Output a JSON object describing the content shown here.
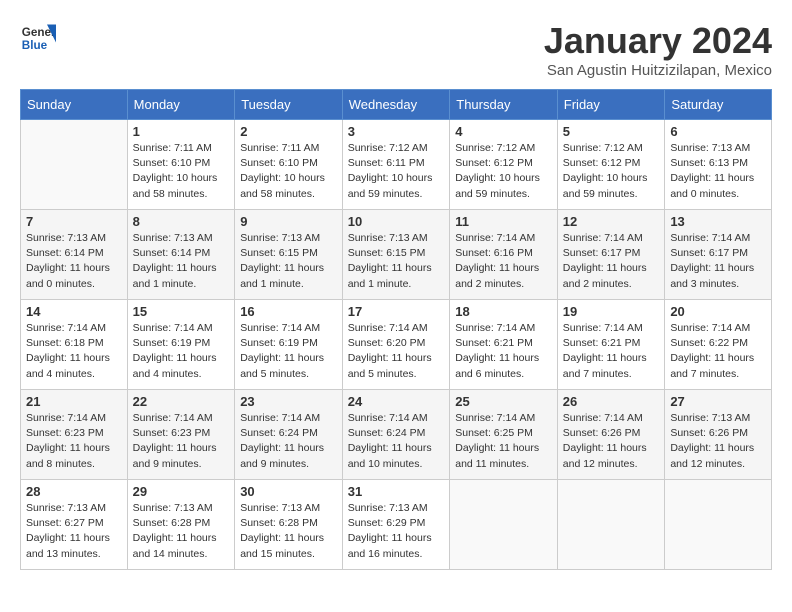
{
  "logo": {
    "line1": "General",
    "line2": "Blue"
  },
  "title": "January 2024",
  "subtitle": "San Agustin Huitzizilapan, Mexico",
  "weekdays": [
    "Sunday",
    "Monday",
    "Tuesday",
    "Wednesday",
    "Thursday",
    "Friday",
    "Saturday"
  ],
  "weeks": [
    [
      {
        "day": "",
        "info": ""
      },
      {
        "day": "1",
        "info": "Sunrise: 7:11 AM\nSunset: 6:10 PM\nDaylight: 10 hours\nand 58 minutes."
      },
      {
        "day": "2",
        "info": "Sunrise: 7:11 AM\nSunset: 6:10 PM\nDaylight: 10 hours\nand 58 minutes."
      },
      {
        "day": "3",
        "info": "Sunrise: 7:12 AM\nSunset: 6:11 PM\nDaylight: 10 hours\nand 59 minutes."
      },
      {
        "day": "4",
        "info": "Sunrise: 7:12 AM\nSunset: 6:12 PM\nDaylight: 10 hours\nand 59 minutes."
      },
      {
        "day": "5",
        "info": "Sunrise: 7:12 AM\nSunset: 6:12 PM\nDaylight: 10 hours\nand 59 minutes."
      },
      {
        "day": "6",
        "info": "Sunrise: 7:13 AM\nSunset: 6:13 PM\nDaylight: 11 hours\nand 0 minutes."
      }
    ],
    [
      {
        "day": "7",
        "info": "Sunrise: 7:13 AM\nSunset: 6:14 PM\nDaylight: 11 hours\nand 0 minutes."
      },
      {
        "day": "8",
        "info": "Sunrise: 7:13 AM\nSunset: 6:14 PM\nDaylight: 11 hours\nand 1 minute."
      },
      {
        "day": "9",
        "info": "Sunrise: 7:13 AM\nSunset: 6:15 PM\nDaylight: 11 hours\nand 1 minute."
      },
      {
        "day": "10",
        "info": "Sunrise: 7:13 AM\nSunset: 6:15 PM\nDaylight: 11 hours\nand 1 minute."
      },
      {
        "day": "11",
        "info": "Sunrise: 7:14 AM\nSunset: 6:16 PM\nDaylight: 11 hours\nand 2 minutes."
      },
      {
        "day": "12",
        "info": "Sunrise: 7:14 AM\nSunset: 6:17 PM\nDaylight: 11 hours\nand 2 minutes."
      },
      {
        "day": "13",
        "info": "Sunrise: 7:14 AM\nSunset: 6:17 PM\nDaylight: 11 hours\nand 3 minutes."
      }
    ],
    [
      {
        "day": "14",
        "info": "Sunrise: 7:14 AM\nSunset: 6:18 PM\nDaylight: 11 hours\nand 4 minutes."
      },
      {
        "day": "15",
        "info": "Sunrise: 7:14 AM\nSunset: 6:19 PM\nDaylight: 11 hours\nand 4 minutes."
      },
      {
        "day": "16",
        "info": "Sunrise: 7:14 AM\nSunset: 6:19 PM\nDaylight: 11 hours\nand 5 minutes."
      },
      {
        "day": "17",
        "info": "Sunrise: 7:14 AM\nSunset: 6:20 PM\nDaylight: 11 hours\nand 5 minutes."
      },
      {
        "day": "18",
        "info": "Sunrise: 7:14 AM\nSunset: 6:21 PM\nDaylight: 11 hours\nand 6 minutes."
      },
      {
        "day": "19",
        "info": "Sunrise: 7:14 AM\nSunset: 6:21 PM\nDaylight: 11 hours\nand 7 minutes."
      },
      {
        "day": "20",
        "info": "Sunrise: 7:14 AM\nSunset: 6:22 PM\nDaylight: 11 hours\nand 7 minutes."
      }
    ],
    [
      {
        "day": "21",
        "info": "Sunrise: 7:14 AM\nSunset: 6:23 PM\nDaylight: 11 hours\nand 8 minutes."
      },
      {
        "day": "22",
        "info": "Sunrise: 7:14 AM\nSunset: 6:23 PM\nDaylight: 11 hours\nand 9 minutes."
      },
      {
        "day": "23",
        "info": "Sunrise: 7:14 AM\nSunset: 6:24 PM\nDaylight: 11 hours\nand 9 minutes."
      },
      {
        "day": "24",
        "info": "Sunrise: 7:14 AM\nSunset: 6:24 PM\nDaylight: 11 hours\nand 10 minutes."
      },
      {
        "day": "25",
        "info": "Sunrise: 7:14 AM\nSunset: 6:25 PM\nDaylight: 11 hours\nand 11 minutes."
      },
      {
        "day": "26",
        "info": "Sunrise: 7:14 AM\nSunset: 6:26 PM\nDaylight: 11 hours\nand 12 minutes."
      },
      {
        "day": "27",
        "info": "Sunrise: 7:13 AM\nSunset: 6:26 PM\nDaylight: 11 hours\nand 12 minutes."
      }
    ],
    [
      {
        "day": "28",
        "info": "Sunrise: 7:13 AM\nSunset: 6:27 PM\nDaylight: 11 hours\nand 13 minutes."
      },
      {
        "day": "29",
        "info": "Sunrise: 7:13 AM\nSunset: 6:28 PM\nDaylight: 11 hours\nand 14 minutes."
      },
      {
        "day": "30",
        "info": "Sunrise: 7:13 AM\nSunset: 6:28 PM\nDaylight: 11 hours\nand 15 minutes."
      },
      {
        "day": "31",
        "info": "Sunrise: 7:13 AM\nSunset: 6:29 PM\nDaylight: 11 hours\nand 16 minutes."
      },
      {
        "day": "",
        "info": ""
      },
      {
        "day": "",
        "info": ""
      },
      {
        "day": "",
        "info": ""
      }
    ]
  ]
}
